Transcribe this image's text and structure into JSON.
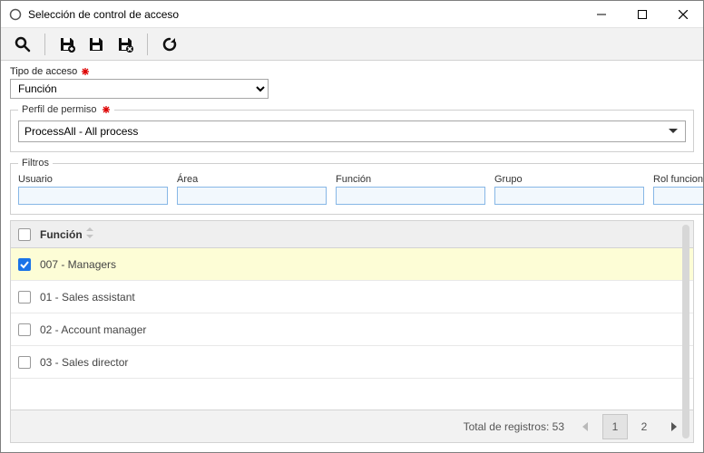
{
  "window": {
    "title": "Selección de control de acceso"
  },
  "access_type": {
    "label": "Tipo de acceso",
    "value": "Función"
  },
  "profile": {
    "legend": "Perfil de permiso",
    "value": "ProcessAll - All process"
  },
  "filters": {
    "legend": "Filtros",
    "columns": {
      "usuario": "Usuario",
      "area": "Área",
      "funcion": "Función",
      "grupo": "Grupo",
      "rol": "Rol funcional"
    },
    "values": {
      "usuario": "",
      "area": "",
      "funcion": "",
      "grupo": "",
      "rol": ""
    }
  },
  "table": {
    "header": "Función",
    "rows": [
      {
        "label": "007 - Managers",
        "checked": true
      },
      {
        "label": "01 - Sales assistant",
        "checked": false
      },
      {
        "label": "02 - Account manager",
        "checked": false
      },
      {
        "label": "03 - Sales director",
        "checked": false
      }
    ]
  },
  "footer": {
    "total_label": "Total de registros: 53",
    "pages": {
      "current": "1",
      "next": "2"
    }
  }
}
